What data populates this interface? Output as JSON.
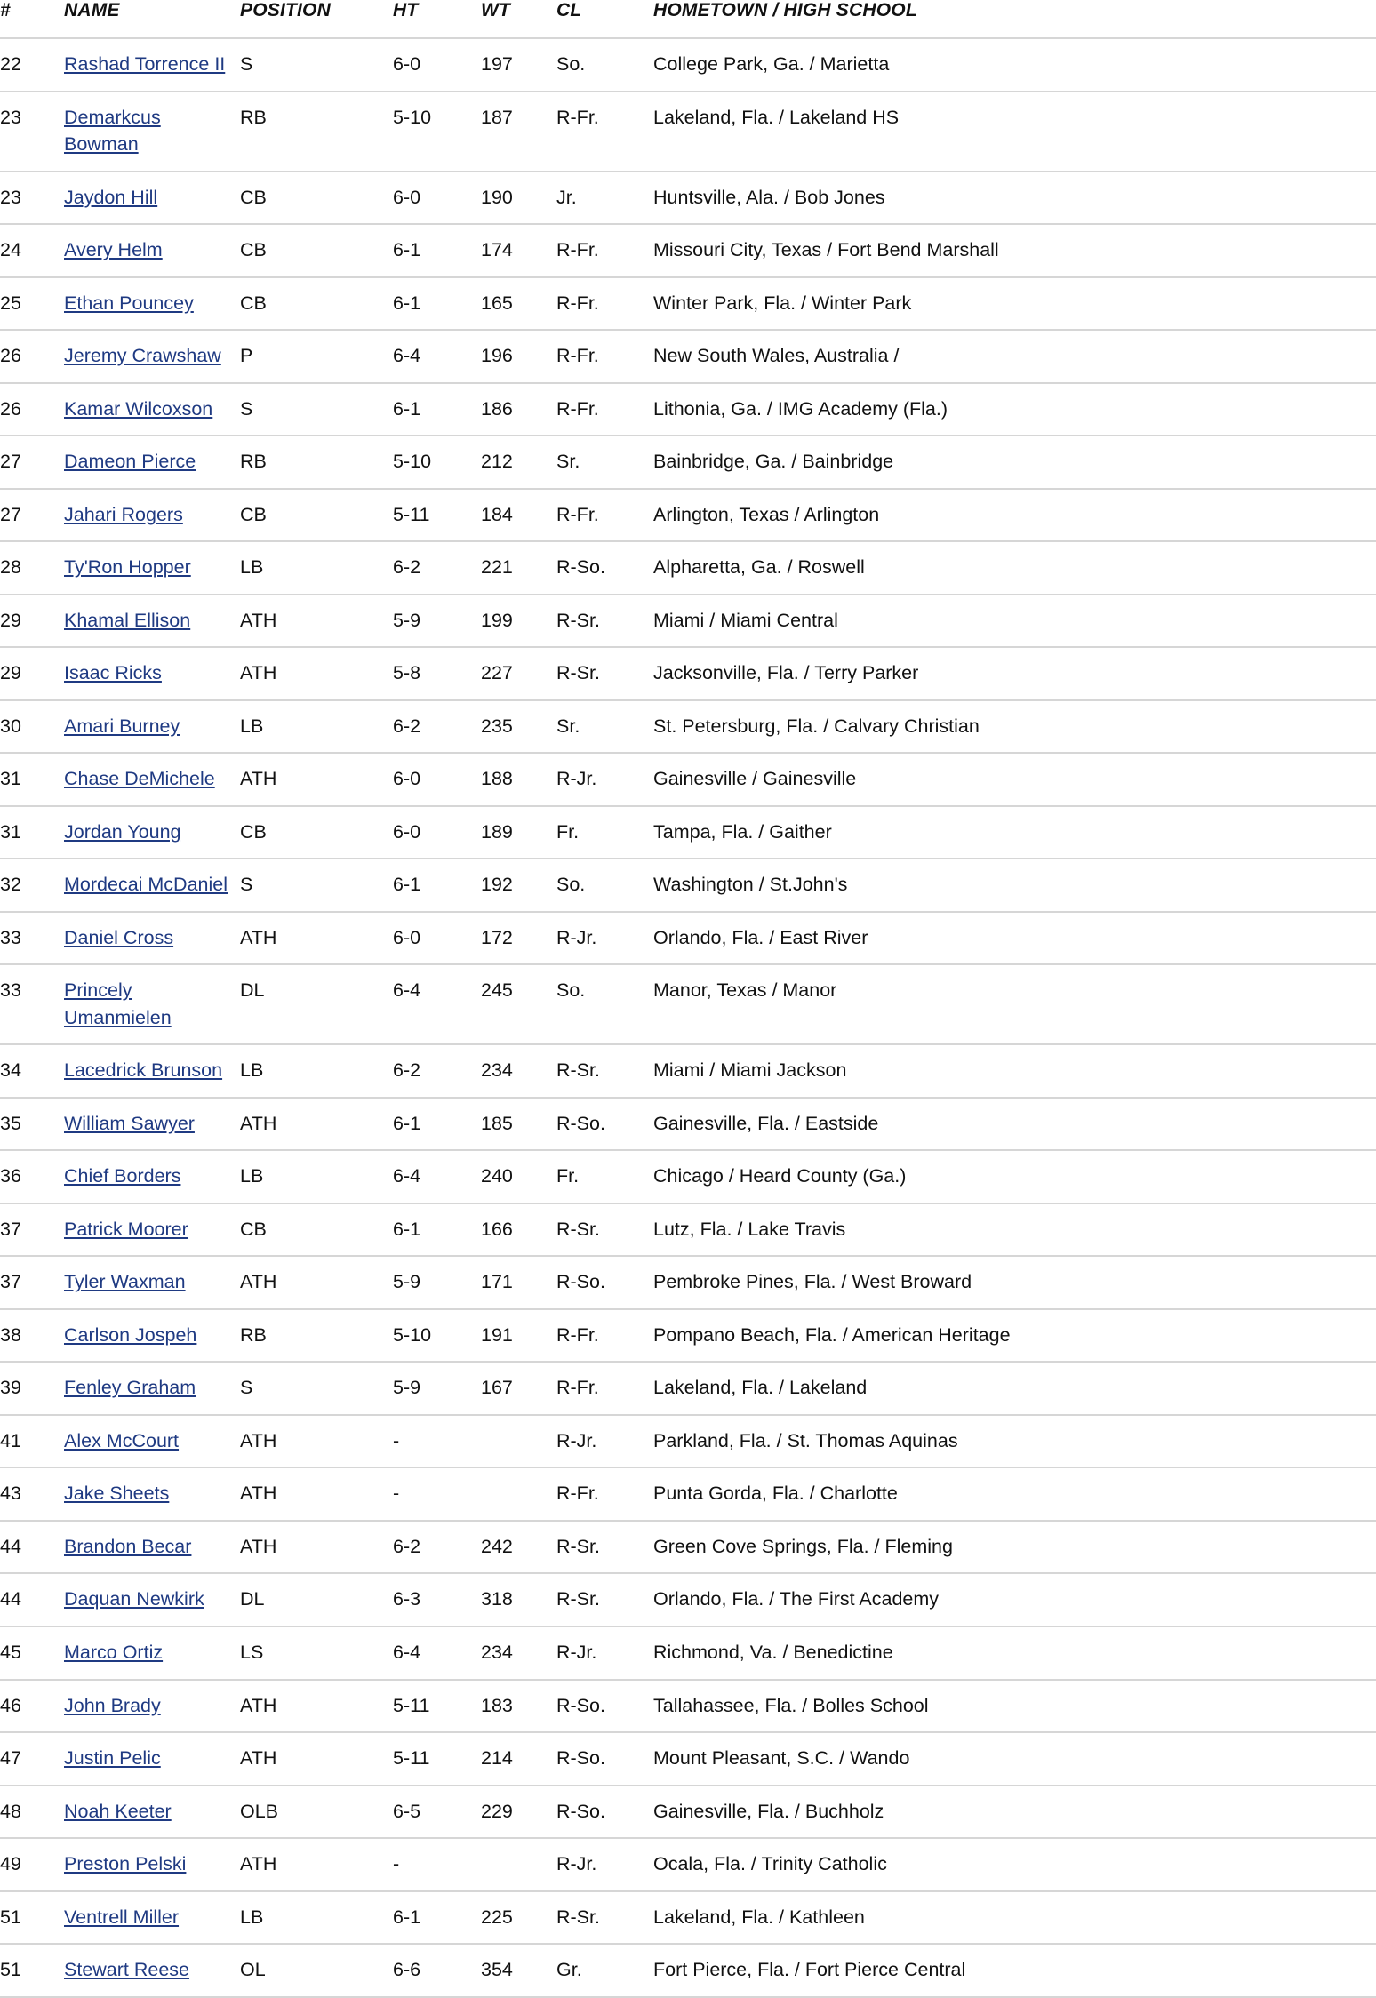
{
  "table": {
    "columns": [
      {
        "key": "number",
        "label": "#"
      },
      {
        "key": "name",
        "label": "NAME"
      },
      {
        "key": "position",
        "label": "POSITION"
      },
      {
        "key": "height",
        "label": "HT"
      },
      {
        "key": "weight",
        "label": "WT"
      },
      {
        "key": "class",
        "label": "CL"
      },
      {
        "key": "hometown",
        "label": "HOMETOWN / HIGH SCHOOL"
      }
    ],
    "link_color": "#1f3a82",
    "row_divider_color": "#d6d6d6",
    "rows": [
      {
        "number": "22",
        "name": "Rashad Torrence II",
        "position": "S",
        "height": "6-0",
        "weight": "197",
        "class": "So.",
        "hometown": "College Park, Ga. / Marietta"
      },
      {
        "number": "23",
        "name": "Demarkcus Bowman",
        "position": "RB",
        "height": "5-10",
        "weight": "187",
        "class": "R-Fr.",
        "hometown": "Lakeland, Fla. / Lakeland HS"
      },
      {
        "number": "23",
        "name": "Jaydon Hill",
        "position": "CB",
        "height": "6-0",
        "weight": "190",
        "class": "Jr.",
        "hometown": "Huntsville, Ala. / Bob Jones"
      },
      {
        "number": "24",
        "name": "Avery Helm",
        "position": "CB",
        "height": "6-1",
        "weight": "174",
        "class": "R-Fr.",
        "hometown": "Missouri City, Texas / Fort Bend Marshall"
      },
      {
        "number": "25",
        "name": "Ethan Pouncey",
        "position": "CB",
        "height": "6-1",
        "weight": "165",
        "class": "R-Fr.",
        "hometown": "Winter Park, Fla. / Winter Park"
      },
      {
        "number": "26",
        "name": "Jeremy Crawshaw",
        "position": "P",
        "height": "6-4",
        "weight": "196",
        "class": "R-Fr.",
        "hometown": "New South Wales, Australia /"
      },
      {
        "number": "26",
        "name": "Kamar Wilcoxson",
        "position": "S",
        "height": "6-1",
        "weight": "186",
        "class": "R-Fr.",
        "hometown": "Lithonia, Ga. / IMG Academy (Fla.)"
      },
      {
        "number": "27",
        "name": "Dameon Pierce",
        "position": "RB",
        "height": "5-10",
        "weight": "212",
        "class": "Sr.",
        "hometown": "Bainbridge, Ga. / Bainbridge"
      },
      {
        "number": "27",
        "name": "Jahari Rogers",
        "position": "CB",
        "height": "5-11",
        "weight": "184",
        "class": "R-Fr.",
        "hometown": "Arlington, Texas / Arlington"
      },
      {
        "number": "28",
        "name": "Ty'Ron Hopper",
        "position": "LB",
        "height": "6-2",
        "weight": "221",
        "class": "R-So.",
        "hometown": "Alpharetta, Ga. / Roswell"
      },
      {
        "number": "29",
        "name": "Khamal Ellison",
        "position": "ATH",
        "height": "5-9",
        "weight": "199",
        "class": "R-Sr.",
        "hometown": "Miami / Miami Central"
      },
      {
        "number": "29",
        "name": "Isaac Ricks",
        "position": "ATH",
        "height": "5-8",
        "weight": "227",
        "class": "R-Sr.",
        "hometown": "Jacksonville, Fla. / Terry Parker"
      },
      {
        "number": "30",
        "name": "Amari Burney",
        "position": "LB",
        "height": "6-2",
        "weight": "235",
        "class": "Sr.",
        "hometown": "St. Petersburg, Fla. / Calvary Christian"
      },
      {
        "number": "31",
        "name": "Chase DeMichele",
        "position": "ATH",
        "height": "6-0",
        "weight": "188",
        "class": "R-Jr.",
        "hometown": "Gainesville / Gainesville"
      },
      {
        "number": "31",
        "name": "Jordan Young",
        "position": "CB",
        "height": "6-0",
        "weight": "189",
        "class": "Fr.",
        "hometown": "Tampa, Fla. / Gaither"
      },
      {
        "number": "32",
        "name": "Mordecai McDaniel",
        "position": "S",
        "height": "6-1",
        "weight": "192",
        "class": "So.",
        "hometown": "Washington / St.John's"
      },
      {
        "number": "33",
        "name": "Daniel Cross",
        "position": "ATH",
        "height": "6-0",
        "weight": "172",
        "class": "R-Jr.",
        "hometown": "Orlando, Fla. / East River"
      },
      {
        "number": "33",
        "name": "Princely Umanmielen",
        "position": "DL",
        "height": "6-4",
        "weight": "245",
        "class": "So.",
        "hometown": "Manor, Texas / Manor"
      },
      {
        "number": "34",
        "name": "Lacedrick Brunson",
        "position": "LB",
        "height": "6-2",
        "weight": "234",
        "class": "R-Sr.",
        "hometown": "Miami / Miami Jackson"
      },
      {
        "number": "35",
        "name": "William Sawyer",
        "position": "ATH",
        "height": "6-1",
        "weight": "185",
        "class": "R-So.",
        "hometown": "Gainesville, Fla. / Eastside"
      },
      {
        "number": "36",
        "name": "Chief Borders",
        "position": "LB",
        "height": "6-4",
        "weight": "240",
        "class": "Fr.",
        "hometown": "Chicago / Heard County (Ga.)"
      },
      {
        "number": "37",
        "name": "Patrick Moorer",
        "position": "CB",
        "height": "6-1",
        "weight": "166",
        "class": "R-Sr.",
        "hometown": "Lutz, Fla. / Lake Travis"
      },
      {
        "number": "37",
        "name": "Tyler Waxman",
        "position": "ATH",
        "height": "5-9",
        "weight": "171",
        "class": "R-So.",
        "hometown": "Pembroke Pines, Fla. / West Broward"
      },
      {
        "number": "38",
        "name": "Carlson Jospeh",
        "position": "RB",
        "height": "5-10",
        "weight": "191",
        "class": "R-Fr.",
        "hometown": "Pompano Beach, Fla. / American Heritage"
      },
      {
        "number": "39",
        "name": "Fenley Graham",
        "position": "S",
        "height": "5-9",
        "weight": "167",
        "class": "R-Fr.",
        "hometown": "Lakeland, Fla. / Lakeland"
      },
      {
        "number": "41",
        "name": "Alex McCourt",
        "position": "ATH",
        "height": "-",
        "weight": "",
        "class": "R-Jr.",
        "hometown": "Parkland, Fla. / St. Thomas Aquinas"
      },
      {
        "number": "43",
        "name": "Jake Sheets",
        "position": "ATH",
        "height": "-",
        "weight": "",
        "class": "R-Fr.",
        "hometown": "Punta Gorda, Fla. / Charlotte"
      },
      {
        "number": "44",
        "name": "Brandon Becar",
        "position": "ATH",
        "height": "6-2",
        "weight": "242",
        "class": "R-Sr.",
        "hometown": "Green Cove Springs, Fla. / Fleming"
      },
      {
        "number": "44",
        "name": "Daquan Newkirk",
        "position": "DL",
        "height": "6-3",
        "weight": "318",
        "class": "R-Sr.",
        "hometown": "Orlando, Fla. / The First Academy"
      },
      {
        "number": "45",
        "name": "Marco Ortiz",
        "position": "LS",
        "height": "6-4",
        "weight": "234",
        "class": "R-Jr.",
        "hometown": "Richmond, Va. / Benedictine"
      },
      {
        "number": "46",
        "name": "John Brady",
        "position": "ATH",
        "height": "5-11",
        "weight": "183",
        "class": "R-So.",
        "hometown": "Tallahassee, Fla. / Bolles School"
      },
      {
        "number": "47",
        "name": "Justin Pelic",
        "position": "ATH",
        "height": "5-11",
        "weight": "214",
        "class": "R-So.",
        "hometown": "Mount Pleasant, S.C. / Wando"
      },
      {
        "number": "48",
        "name": "Noah Keeter",
        "position": "OLB",
        "height": "6-5",
        "weight": "229",
        "class": "R-So.",
        "hometown": "Gainesville, Fla. / Buchholz"
      },
      {
        "number": "49",
        "name": "Preston Pelski",
        "position": "ATH",
        "height": "-",
        "weight": "",
        "class": "R-Jr.",
        "hometown": "Ocala, Fla. / Trinity Catholic"
      },
      {
        "number": "51",
        "name": "Ventrell Miller",
        "position": "LB",
        "height": "6-1",
        "weight": "225",
        "class": "R-Sr.",
        "hometown": "Lakeland, Fla. / Kathleen"
      },
      {
        "number": "51",
        "name": "Stewart Reese",
        "position": "OL",
        "height": "6-6",
        "weight": "354",
        "class": "Gr.",
        "hometown": "Fort Pierce, Fla. / Fort Pierce Central"
      }
    ]
  }
}
